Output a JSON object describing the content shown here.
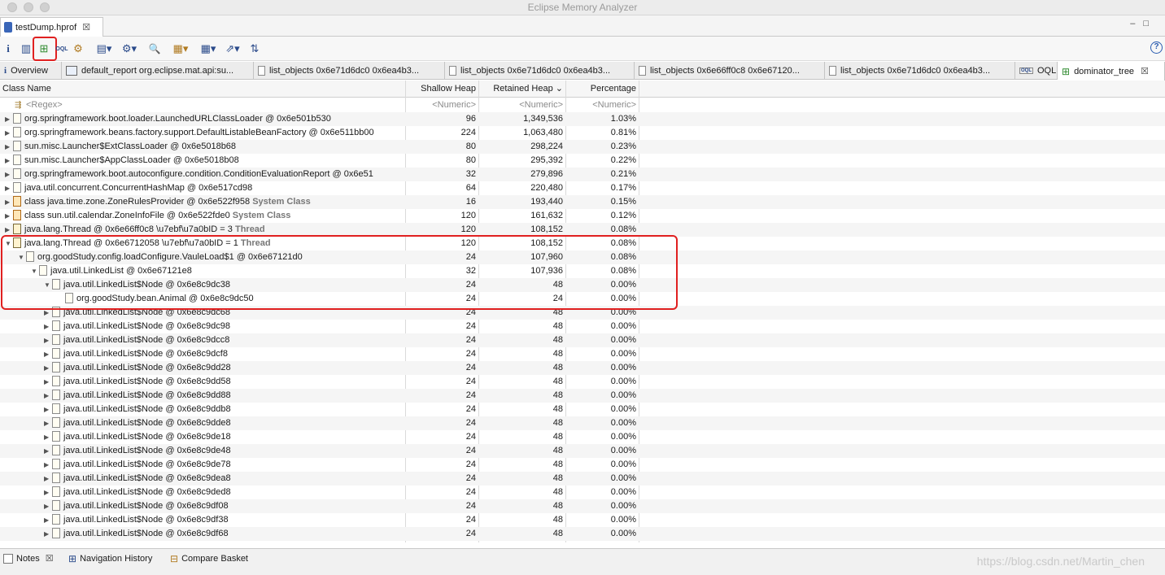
{
  "window": {
    "app_title": "Eclipse Memory Analyzer"
  },
  "editor": {
    "tab_label": "testDump.hprof",
    "close": "☒"
  },
  "toolbar": {
    "info": "i",
    "histogram": "▥",
    "dominator": "⊞",
    "oql": "OQL",
    "heapdump_overview": "⚙",
    "reports": "▤▾",
    "queries": "⚙▾",
    "search": "🔍",
    "group": "▦▾",
    "calculate": "▦▾",
    "export": "⇗▾",
    "sort": "⇅",
    "help": "?"
  },
  "result_tabs": [
    {
      "icon": "i",
      "label": "Overview"
    },
    {
      "icon": "report",
      "label": "default_report  org.eclipse.mat.api:su..."
    },
    {
      "icon": "doc",
      "label": "list_objects  0x6e71d6dc0 0x6ea4b3..."
    },
    {
      "icon": "doc",
      "label": "list_objects  0x6e71d6dc0 0x6ea4b3..."
    },
    {
      "icon": "doc",
      "label": "list_objects  0x6e66ff0c8 0x6e67120..."
    },
    {
      "icon": "doc",
      "label": "list_objects  0x6e71d6dc0 0x6ea4b3..."
    },
    {
      "icon": "oql",
      "label": "OQL"
    },
    {
      "icon": "tree",
      "label": "dominator_tree",
      "close": "☒"
    }
  ],
  "table": {
    "headers": {
      "name": "Class Name",
      "shallow": "Shallow Heap",
      "retained": "Retained Heap",
      "retained_sort": "⌄",
      "pct": "Percentage"
    },
    "filter_row": {
      "name": "<Regex>",
      "shallow": "<Numeric>",
      "retained": "<Numeric>",
      "pct": "<Numeric>"
    },
    "rows": [
      {
        "name": "org.springframework.boot.loader.LaunchedURLClassLoader @ 0x6e501b530",
        "sys": "",
        "shallow": "96",
        "retained": "1,349,536",
        "pct": "1.03%"
      },
      {
        "name": "org.springframework.beans.factory.support.DefaultListableBeanFactory @ 0x6e511bb00",
        "sys": "",
        "shallow": "224",
        "retained": "1,063,480",
        "pct": "0.81%"
      },
      {
        "name": "sun.misc.Launcher$ExtClassLoader @ 0x6e5018b68",
        "sys": "",
        "shallow": "80",
        "retained": "298,224",
        "pct": "0.23%"
      },
      {
        "name": "sun.misc.Launcher$AppClassLoader @ 0x6e5018b08",
        "sys": "",
        "shallow": "80",
        "retained": "295,392",
        "pct": "0.22%"
      },
      {
        "name": "org.springframework.boot.autoconfigure.condition.ConditionEvaluationReport @ 0x6e51",
        "sys": "",
        "shallow": "32",
        "retained": "279,896",
        "pct": "0.21%"
      },
      {
        "name": "java.util.concurrent.ConcurrentHashMap @ 0x6e517cd98",
        "sys": "",
        "shallow": "64",
        "retained": "220,480",
        "pct": "0.17%"
      },
      {
        "name": "class java.time.zone.ZoneRulesProvider @ 0x6e522f958",
        "sys": "System Class",
        "shallow": "16",
        "retained": "193,440",
        "pct": "0.15%"
      },
      {
        "name": "class sun.util.calendar.ZoneInfoFile @ 0x6e522fde0",
        "sys": "System Class",
        "shallow": "120",
        "retained": "161,632",
        "pct": "0.12%"
      },
      {
        "name": "java.lang.Thread @ 0x6e66ff0c8  \\u7ebf\\u7a0bID = 3",
        "sys": "Thread",
        "shallow": "120",
        "retained": "108,152",
        "pct": "0.08%"
      },
      {
        "name": "java.lang.Thread @ 0x6e6712058  \\u7ebf\\u7a0bID = 1",
        "sys": "Thread",
        "shallow": "120",
        "retained": "108,152",
        "pct": "0.08%"
      },
      {
        "name": "org.goodStudy.config.loadConfigure.VauleLoad$1 @ 0x6e67121d0",
        "sys": "",
        "shallow": "24",
        "retained": "107,960",
        "pct": "0.08%"
      },
      {
        "name": "java.util.LinkedList @ 0x6e67121e8",
        "sys": "",
        "shallow": "32",
        "retained": "107,936",
        "pct": "0.08%"
      },
      {
        "name": "java.util.LinkedList$Node @ 0x6e8c9dc38",
        "sys": "",
        "shallow": "24",
        "retained": "48",
        "pct": "0.00%"
      },
      {
        "name": "org.goodStudy.bean.Animal @ 0x6e8c9dc50",
        "sys": "",
        "shallow": "24",
        "retained": "24",
        "pct": "0.00%"
      },
      {
        "name": "java.util.LinkedList$Node @ 0x6e8c9dc68",
        "sys": "",
        "shallow": "24",
        "retained": "48",
        "pct": "0.00%"
      },
      {
        "name": "java.util.LinkedList$Node @ 0x6e8c9dc98",
        "sys": "",
        "shallow": "24",
        "retained": "48",
        "pct": "0.00%"
      },
      {
        "name": "java.util.LinkedList$Node @ 0x6e8c9dcc8",
        "sys": "",
        "shallow": "24",
        "retained": "48",
        "pct": "0.00%"
      },
      {
        "name": "java.util.LinkedList$Node @ 0x6e8c9dcf8",
        "sys": "",
        "shallow": "24",
        "retained": "48",
        "pct": "0.00%"
      },
      {
        "name": "java.util.LinkedList$Node @ 0x6e8c9dd28",
        "sys": "",
        "shallow": "24",
        "retained": "48",
        "pct": "0.00%"
      },
      {
        "name": "java.util.LinkedList$Node @ 0x6e8c9dd58",
        "sys": "",
        "shallow": "24",
        "retained": "48",
        "pct": "0.00%"
      },
      {
        "name": "java.util.LinkedList$Node @ 0x6e8c9dd88",
        "sys": "",
        "shallow": "24",
        "retained": "48",
        "pct": "0.00%"
      },
      {
        "name": "java.util.LinkedList$Node @ 0x6e8c9ddb8",
        "sys": "",
        "shallow": "24",
        "retained": "48",
        "pct": "0.00%"
      },
      {
        "name": "java.util.LinkedList$Node @ 0x6e8c9dde8",
        "sys": "",
        "shallow": "24",
        "retained": "48",
        "pct": "0.00%"
      },
      {
        "name": "java.util.LinkedList$Node @ 0x6e8c9de18",
        "sys": "",
        "shallow": "24",
        "retained": "48",
        "pct": "0.00%"
      },
      {
        "name": "java.util.LinkedList$Node @ 0x6e8c9de48",
        "sys": "",
        "shallow": "24",
        "retained": "48",
        "pct": "0.00%"
      },
      {
        "name": "java.util.LinkedList$Node @ 0x6e8c9de78",
        "sys": "",
        "shallow": "24",
        "retained": "48",
        "pct": "0.00%"
      },
      {
        "name": "java.util.LinkedList$Node @ 0x6e8c9dea8",
        "sys": "",
        "shallow": "24",
        "retained": "48",
        "pct": "0.00%"
      },
      {
        "name": "java.util.LinkedList$Node @ 0x6e8c9ded8",
        "sys": "",
        "shallow": "24",
        "retained": "48",
        "pct": "0.00%"
      },
      {
        "name": "java.util.LinkedList$Node @ 0x6e8c9df08",
        "sys": "",
        "shallow": "24",
        "retained": "48",
        "pct": "0.00%"
      },
      {
        "name": "java.util.LinkedList$Node @ 0x6e8c9df38",
        "sys": "",
        "shallow": "24",
        "retained": "48",
        "pct": "0.00%"
      },
      {
        "name": "java.util.LinkedList$Node @ 0x6e8c9df68",
        "sys": "",
        "shallow": "24",
        "retained": "48",
        "pct": "0.00%"
      }
    ]
  },
  "bottom_views": {
    "notes": "Notes",
    "notes_close": "☒",
    "nav_history": "Navigation History",
    "compare_basket": "Compare Basket",
    "watermark": "https://blog.csdn.net/Martin_chen"
  },
  "colors": {
    "highlight": "#e02020",
    "accent": "#2a5cb0"
  }
}
